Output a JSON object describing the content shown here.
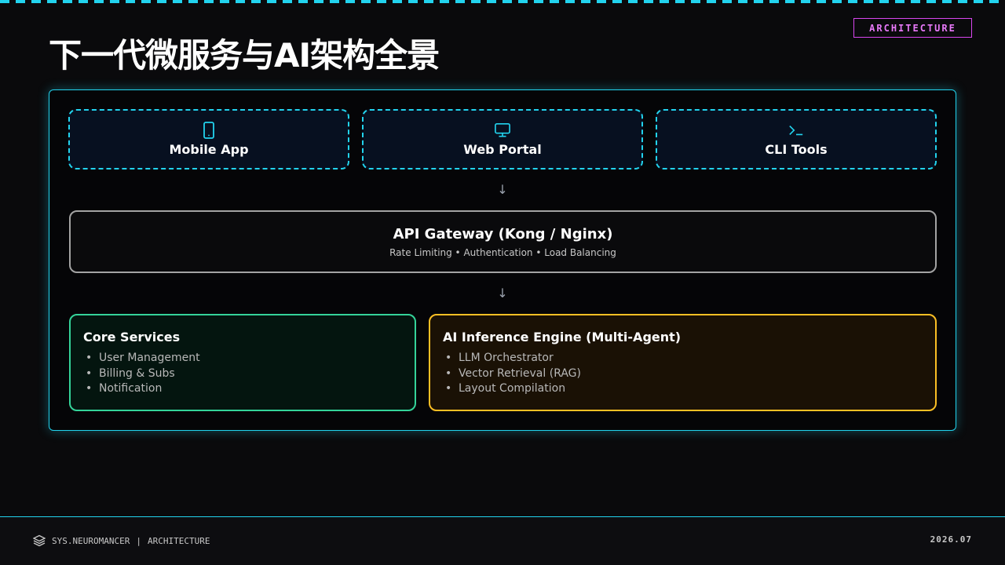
{
  "header": {
    "badge": "ARCHITECTURE",
    "title": "下一代微服务与AI架构全景"
  },
  "clients": [
    {
      "label": "Mobile App",
      "icon": "smartphone-icon"
    },
    {
      "label": "Web Portal",
      "icon": "monitor-icon"
    },
    {
      "label": "CLI Tools",
      "icon": "terminal-icon"
    }
  ],
  "arrows": {
    "glyph": "↓"
  },
  "gateway": {
    "title": "API Gateway (Kong / Nginx)",
    "subtitle": "Rate Limiting • Authentication • Load Balancing"
  },
  "services": {
    "core": {
      "title": "Core Services",
      "items": [
        "User Management",
        "Billing & Subs",
        "Notification"
      ]
    },
    "ai": {
      "title": "AI Inference Engine (Multi-Agent)",
      "items": [
        "LLM Orchestrator",
        "Vector Retrieval (RAG)",
        "Layout Compilation"
      ]
    }
  },
  "footer": {
    "brand": "SYS.NEUROMANCER",
    "divider": "|",
    "section": "ARCHITECTURE",
    "date": "2026.07",
    "icon": "layers-icon"
  },
  "colors": {
    "accent": "#22d3ee",
    "badge": "#d946ef",
    "core": "#34d399",
    "ai": "#fbbf24"
  }
}
